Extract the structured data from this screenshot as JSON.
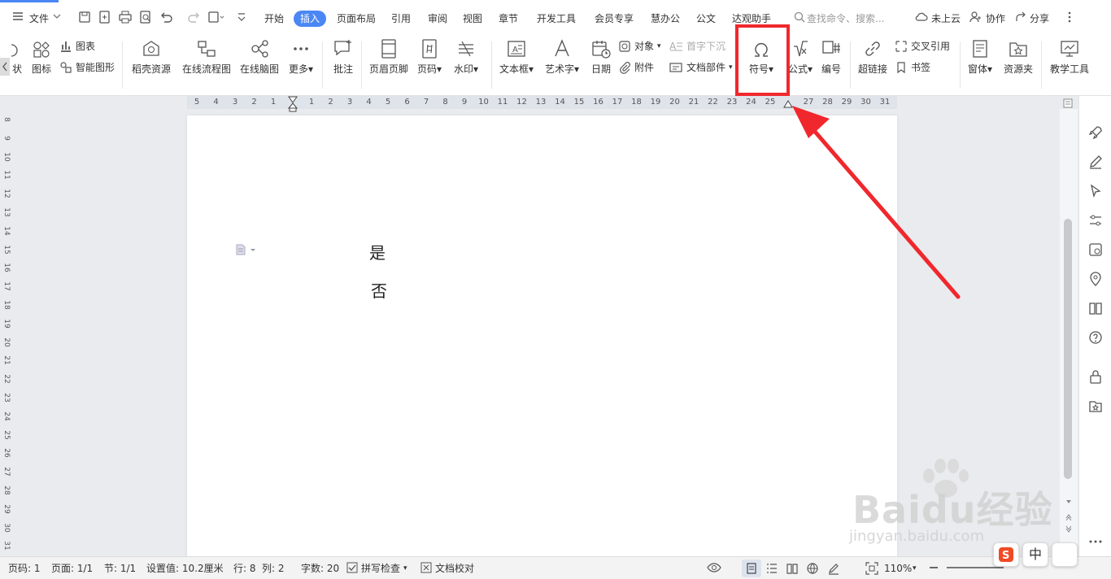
{
  "menu": {
    "file_label": "文件",
    "tabs": [
      {
        "label": "开始",
        "active": false
      },
      {
        "label": "插入",
        "active": true
      },
      {
        "label": "页面布局",
        "active": false
      },
      {
        "label": "引用",
        "active": false
      },
      {
        "label": "审阅",
        "active": false
      },
      {
        "label": "视图",
        "active": false
      },
      {
        "label": "章节",
        "active": false
      },
      {
        "label": "开发工具",
        "active": false
      },
      {
        "label": "会员专享",
        "active": false
      },
      {
        "label": "慧办公",
        "active": false
      },
      {
        "label": "公文",
        "active": false
      },
      {
        "label": "达观助手",
        "active": false
      }
    ],
    "search_placeholder": "查找命令、搜索...",
    "cloud_label": "未上云",
    "collab_label": "协作",
    "share_label": "分享",
    "accent_color": "#4a86f5"
  },
  "ribbon": {
    "partial_left_label": "状",
    "icon_label": "图标",
    "chart_label": "图表",
    "smartart_label": "智能图形",
    "daoke_label": "稻壳资源",
    "flowchart_label": "在线流程图",
    "mindmap_label": "在线脑图",
    "more_label": "更多",
    "comment_label": "批注",
    "header_footer_label": "页眉页脚",
    "page_number_label": "页码",
    "watermark_label": "水印",
    "textbox_label": "文本框",
    "wordart_label": "艺术字",
    "date_label": "日期",
    "object_label": "对象",
    "attachment_label": "附件",
    "dropcap_label": "首字下沉",
    "doc_parts_label": "文档部件",
    "symbol_label": "符号",
    "formula_label": "公式",
    "numbering_label": "编号",
    "hyperlink_label": "超链接",
    "crossref_label": "交叉引用",
    "bookmark_label": "书签",
    "window_label": "窗体",
    "resource_label": "资源夹",
    "teaching_label": "教学工具"
  },
  "ruler": {
    "numbers": [
      "5",
      "4",
      "3",
      "2",
      "1",
      "",
      "1",
      "2",
      "3",
      "4",
      "5",
      "6",
      "7",
      "8",
      "9",
      "10",
      "11",
      "12",
      "13",
      "14",
      "15",
      "16",
      "17",
      "18",
      "19",
      "20",
      "21",
      "22",
      "23",
      "24",
      "25",
      "",
      "27",
      "28",
      "29",
      "30",
      "31"
    ],
    "vertical": [
      "8",
      "9",
      "10",
      "11",
      "12",
      "13",
      "14",
      "15",
      "16",
      "17",
      "18",
      "19",
      "20",
      "21",
      "22",
      "23",
      "24",
      "25",
      "26",
      "27",
      "28",
      "29",
      "30",
      "31"
    ]
  },
  "document": {
    "lines": [
      "是",
      "否"
    ]
  },
  "status": {
    "page_code": "页码: 1",
    "pages": "页面: 1/1",
    "section": "节: 1/1",
    "setting": "设置值: 10.2厘米",
    "row": "行: 8",
    "col": "列: 2",
    "word_count": "字数: 20",
    "spellcheck": "拼写检查",
    "proofread": "文档校对",
    "zoom": "110%"
  },
  "watermark": {
    "brand": "Baidu经验",
    "url": "jingyan.baidu.com"
  },
  "ime": {
    "lang": "中"
  },
  "highlight_color": "#f0282d"
}
